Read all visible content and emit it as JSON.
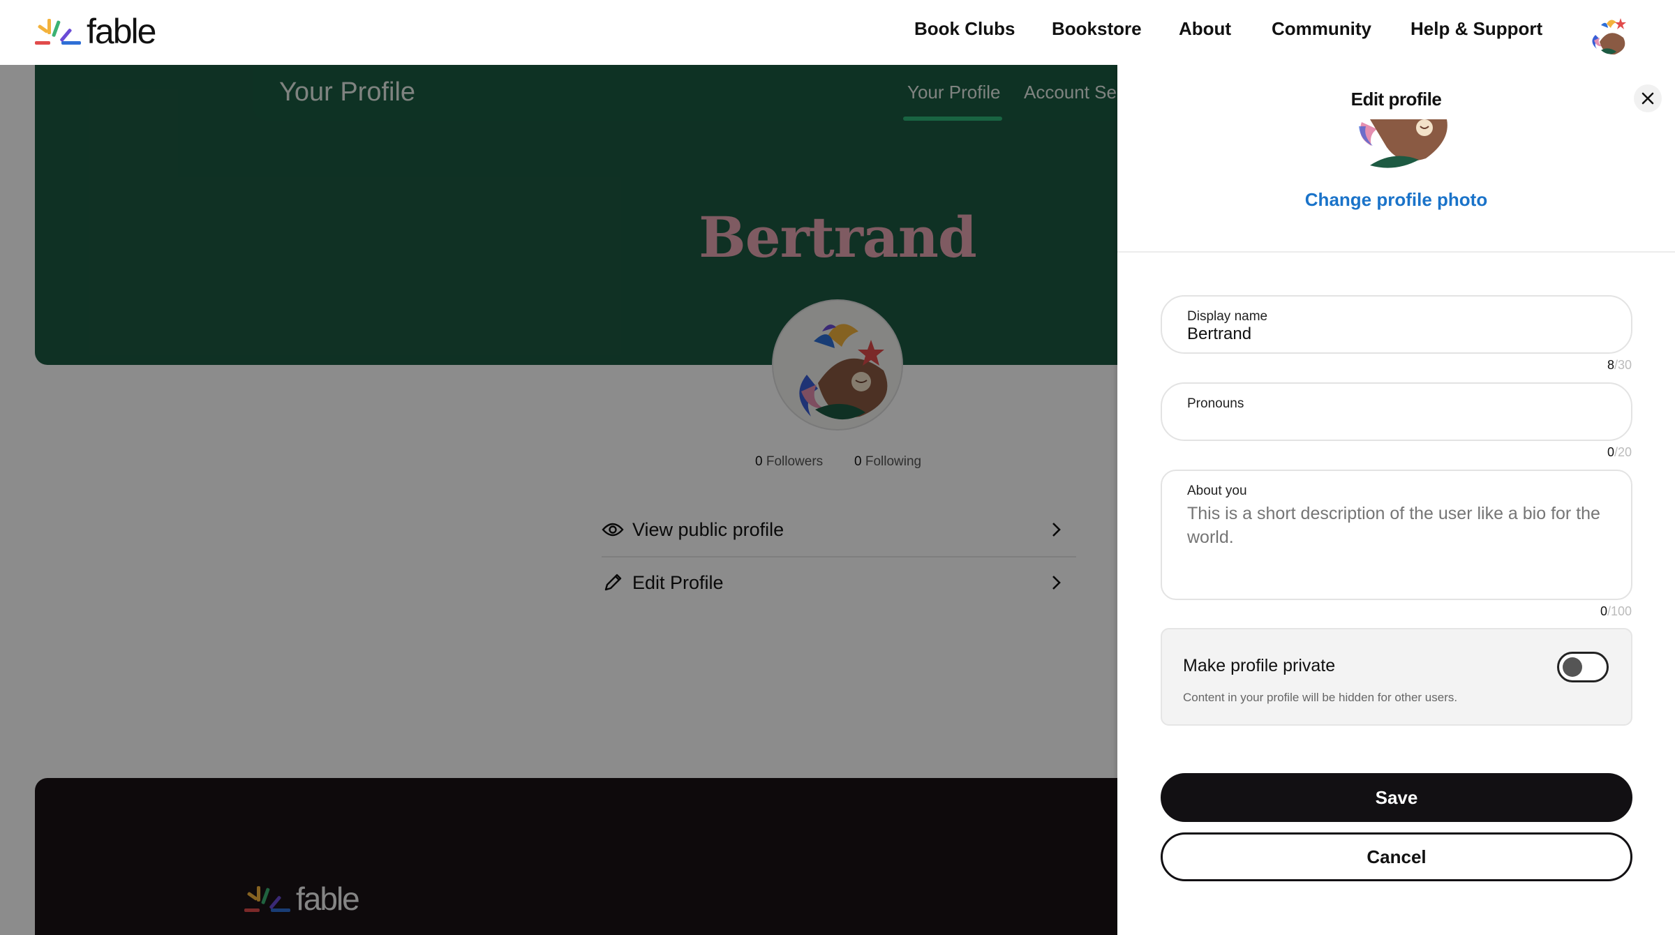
{
  "brand": {
    "name": "fable"
  },
  "nav": {
    "items": [
      {
        "label": "Book Clubs"
      },
      {
        "label": "Bookstore"
      },
      {
        "label": "About"
      },
      {
        "label": "Community"
      },
      {
        "label": "Help & Support"
      }
    ],
    "avatar_icon": "user-avatar-icon"
  },
  "subnav": {
    "title": "Your Profile",
    "tabs": [
      {
        "label": "Your Profile",
        "active": true
      },
      {
        "label": "Account Se"
      }
    ]
  },
  "profile": {
    "name": "Bertrand",
    "followers_count": "0",
    "followers_label": "Followers",
    "following_count": "0",
    "following_label": "Following",
    "menu": [
      {
        "label": "View public profile",
        "icon": "eye-icon"
      },
      {
        "label": "Edit Profile",
        "icon": "pencil-icon"
      }
    ]
  },
  "edit_panel": {
    "title": "Edit profile",
    "change_photo": "Change profile photo",
    "display_name": {
      "label": "Display name",
      "value": "Bertrand",
      "count": "8",
      "max": "/30"
    },
    "pronouns": {
      "label": "Pronouns",
      "value": "",
      "count": "0",
      "max": "/20"
    },
    "about": {
      "label": "About you",
      "placeholder": "This is a short description of the user like a bio for the world.",
      "count": "0",
      "max": "/100"
    },
    "private": {
      "title": "Make profile private",
      "description": "Content in your profile will be hidden for other users.",
      "enabled": false
    },
    "save_label": "Save",
    "cancel_label": "Cancel"
  },
  "colors": {
    "hero_green": "#1d5a42",
    "accent_blue": "#1a73c9",
    "name_pink": "#e8a6b2",
    "button_dark": "#121013"
  }
}
